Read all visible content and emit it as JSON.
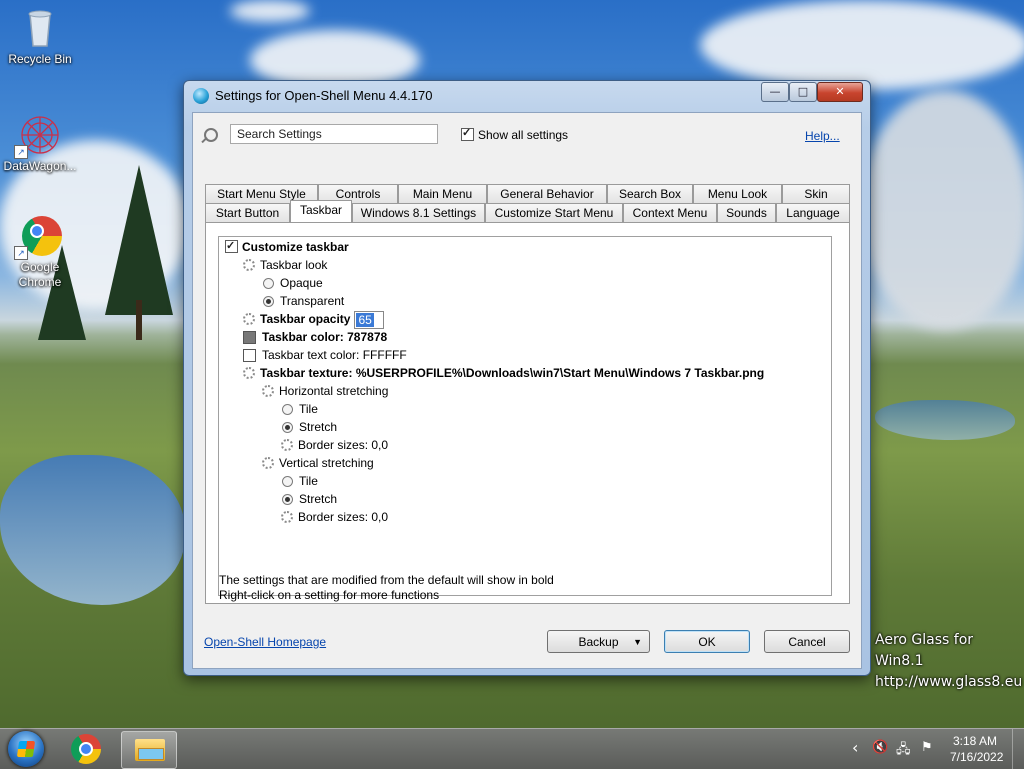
{
  "desktop": {
    "icons": [
      {
        "label": "Recycle Bin",
        "icon": "recycle-bin-icon"
      },
      {
        "label": "DataWagon...",
        "icon": "datawagon-icon"
      },
      {
        "label": "Google Chrome",
        "icon": "chrome-icon"
      }
    ],
    "watermark_line1": "Aero Glass for Win8.1",
    "watermark_line2": "http://www.glass8.eu"
  },
  "window": {
    "title": "Settings for Open-Shell Menu 4.4.170",
    "caption_min": "—",
    "caption_max": "□",
    "caption_close": "✕"
  },
  "search": {
    "value": "Search Settings",
    "show_all_label": "Show all settings",
    "show_all_checked": true,
    "help_label": "Help..."
  },
  "tabs": {
    "row1": [
      "Start Menu Style",
      "Controls",
      "Main Menu",
      "General Behavior",
      "Search Box",
      "Menu Look",
      "Skin"
    ],
    "row2": [
      "Start Button",
      "Taskbar",
      "Windows 8.1 Settings",
      "Customize Start Menu",
      "Context Menu",
      "Sounds",
      "Language"
    ],
    "active": "Taskbar"
  },
  "tree": {
    "customize_taskbar": "Customize taskbar",
    "taskbar_look": "Taskbar look",
    "opaque": "Opaque",
    "transparent": "Transparent",
    "taskbar_opacity": "Taskbar opacity",
    "opacity_value": "65",
    "taskbar_color": "Taskbar color: 787878",
    "taskbar_color_hex": "#787878",
    "taskbar_text_color": "Taskbar text color: FFFFFF",
    "taskbar_text_color_hex": "#FFFFFF",
    "taskbar_texture": "Taskbar texture: %USERPROFILE%\\Downloads\\win7\\Start Menu\\Windows 7 Taskbar.png",
    "horizontal_stretching": "Horizontal stretching",
    "h_tile": "Tile",
    "h_stretch": "Stretch",
    "h_border": "Border sizes: 0,0",
    "vertical_stretching": "Vertical stretching",
    "v_tile": "Tile",
    "v_stretch": "Stretch",
    "v_border": "Border sizes: 0,0"
  },
  "footer": {
    "info_line1": "The settings that are modified from the default will show in bold",
    "info_line2": "Right-click on a setting for more functions",
    "homepage_link": "Open-Shell Homepage",
    "backup_label": "Backup",
    "ok_label": "OK",
    "cancel_label": "Cancel"
  },
  "taskbar": {
    "clock_time": "3:18 AM",
    "clock_date": "7/16/2022",
    "tray_chevron": "‹",
    "tray_volume": "🔇",
    "tray_network": "🖧",
    "tray_flag": "⚑"
  }
}
